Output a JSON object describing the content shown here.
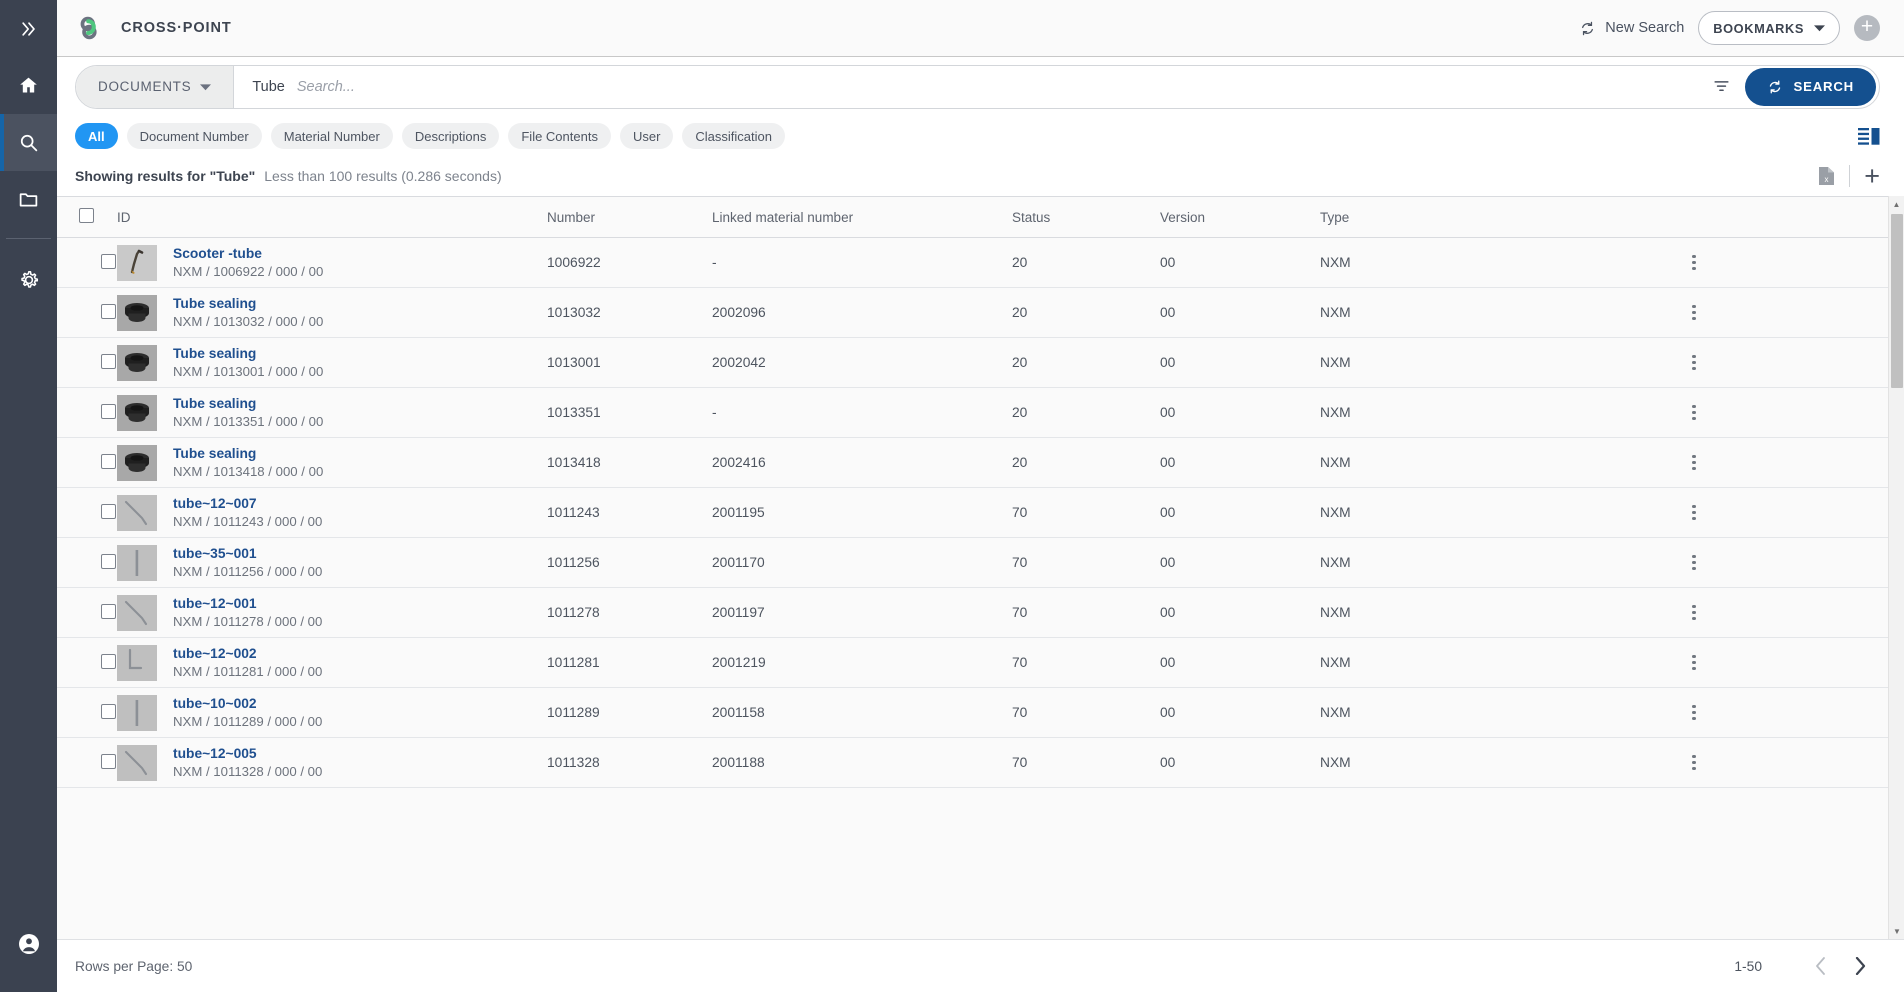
{
  "sidebar": {
    "collapse_icon": "chevron-double-right-icon",
    "items": [
      {
        "icon": "home-icon",
        "name": "home",
        "active": false
      },
      {
        "icon": "search-icon",
        "name": "search",
        "active": true
      },
      {
        "icon": "folder-icon",
        "name": "folders",
        "active": false
      },
      {
        "icon": "gear-icon",
        "name": "settings",
        "active": false
      }
    ],
    "account_icon": "account-circle-icon"
  },
  "header": {
    "logo_icon": "crosspoint-logo-icon",
    "brand": "CROSS·POINT",
    "new_search_label": "New Search",
    "new_search_icon": "refresh-icon",
    "bookmarks_label": "BOOKMARKS",
    "bookmarks_caret_icon": "chevron-down-icon",
    "add_icon": "plus-circle-icon",
    "accent_color": "#14508f"
  },
  "search": {
    "scope_label": "DOCUMENTS",
    "scope_caret_icon": "chevron-down-icon",
    "query_chip": "Tube",
    "placeholder": "Search...",
    "filter_icon": "filter-funnel-icon",
    "search_button_label": "SEARCH",
    "search_button_icon": "refresh-icon"
  },
  "filters": {
    "chips": [
      {
        "label": "All",
        "active": true
      },
      {
        "label": "Document Number",
        "active": false
      },
      {
        "label": "Material Number",
        "active": false
      },
      {
        "label": "Descriptions",
        "active": false
      },
      {
        "label": "File Contents",
        "active": false
      },
      {
        "label": "User",
        "active": false
      },
      {
        "label": "Classification",
        "active": false
      }
    ],
    "view_toggle_icon": "list-view-icon"
  },
  "results_info": {
    "showing_text": "Showing results for \"Tube\"",
    "meta_text": "Less than 100 results (0.286 seconds)",
    "export_icon": "excel-export-icon",
    "add_icon": "plus-icon"
  },
  "table": {
    "columns": [
      "ID",
      "Number",
      "Linked material number",
      "Status",
      "Version",
      "Type"
    ],
    "rows": [
      {
        "title": "Scooter -tube",
        "sub": "NXM / 1006922 / 000 / 00",
        "number": "1006922",
        "linked": "-",
        "status": "20",
        "version": "00",
        "type": "NXM",
        "thumb": "scooter-tube-thumb"
      },
      {
        "title": "Tube sealing",
        "sub": "NXM / 1013032 / 000 / 00",
        "number": "1013032",
        "linked": "2002096",
        "status": "20",
        "version": "00",
        "type": "NXM",
        "thumb": "tube-sealing-thumb"
      },
      {
        "title": "Tube sealing",
        "sub": "NXM / 1013001 / 000 / 00",
        "number": "1013001",
        "linked": "2002042",
        "status": "20",
        "version": "00",
        "type": "NXM",
        "thumb": "tube-sealing-thumb"
      },
      {
        "title": "Tube sealing",
        "sub": "NXM / 1013351 / 000 / 00",
        "number": "1013351",
        "linked": "-",
        "status": "20",
        "version": "00",
        "type": "NXM",
        "thumb": "tube-sealing-thumb"
      },
      {
        "title": "Tube sealing",
        "sub": "NXM / 1013418 / 000 / 00",
        "number": "1013418",
        "linked": "2002416",
        "status": "20",
        "version": "00",
        "type": "NXM",
        "thumb": "tube-sealing-thumb"
      },
      {
        "title": "tube~12~007",
        "sub": "NXM / 1011243 / 000 / 00",
        "number": "1011243",
        "linked": "2001195",
        "status": "70",
        "version": "00",
        "type": "NXM",
        "thumb": "tube-bent-thumb"
      },
      {
        "title": "tube~35~001",
        "sub": "NXM / 1011256 / 000 / 00",
        "number": "1011256",
        "linked": "2001170",
        "status": "70",
        "version": "00",
        "type": "NXM",
        "thumb": "tube-straight-thumb"
      },
      {
        "title": "tube~12~001",
        "sub": "NXM / 1011278 / 000 / 00",
        "number": "1011278",
        "linked": "2001197",
        "status": "70",
        "version": "00",
        "type": "NXM",
        "thumb": "tube-bent-thumb"
      },
      {
        "title": "tube~12~002",
        "sub": "NXM / 1011281 / 000 / 00",
        "number": "1011281",
        "linked": "2001219",
        "status": "70",
        "version": "00",
        "type": "NXM",
        "thumb": "tube-angle-thumb"
      },
      {
        "title": "tube~10~002",
        "sub": "NXM / 1011289 / 000 / 00",
        "number": "1011289",
        "linked": "2001158",
        "status": "70",
        "version": "00",
        "type": "NXM",
        "thumb": "tube-straight-thumb"
      },
      {
        "title": "tube~12~005",
        "sub": "NXM / 1011328 / 000 / 00",
        "number": "1011328",
        "linked": "2001188",
        "status": "70",
        "version": "00",
        "type": "NXM",
        "thumb": "tube-bent-thumb"
      }
    ],
    "row_menu_icon": "kebab-menu-icon"
  },
  "footer": {
    "rows_per_page_label": "Rows per Page: 50",
    "page_range": "1-50",
    "prev_icon": "chevron-left-icon",
    "next_icon": "chevron-right-icon"
  }
}
